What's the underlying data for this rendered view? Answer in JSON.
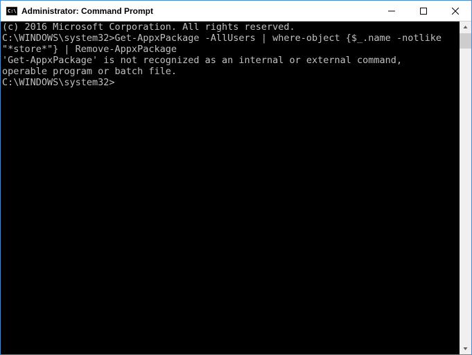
{
  "window": {
    "title": "Administrator: Command Prompt"
  },
  "terminal": {
    "line1": "(c) 2016 Microsoft Corporation. All rights reserved.",
    "blank1": "",
    "line2": "C:\\WINDOWS\\system32>Get-AppxPackage -AllUsers | where-object {$_.name -notlike \"*store*\"} | Remove-AppxPackage",
    "line3": "'Get-AppxPackage' is not recognized as an internal or external command,",
    "line4": "operable program or batch file.",
    "blank2": "",
    "prompt": "C:\\WINDOWS\\system32>"
  }
}
